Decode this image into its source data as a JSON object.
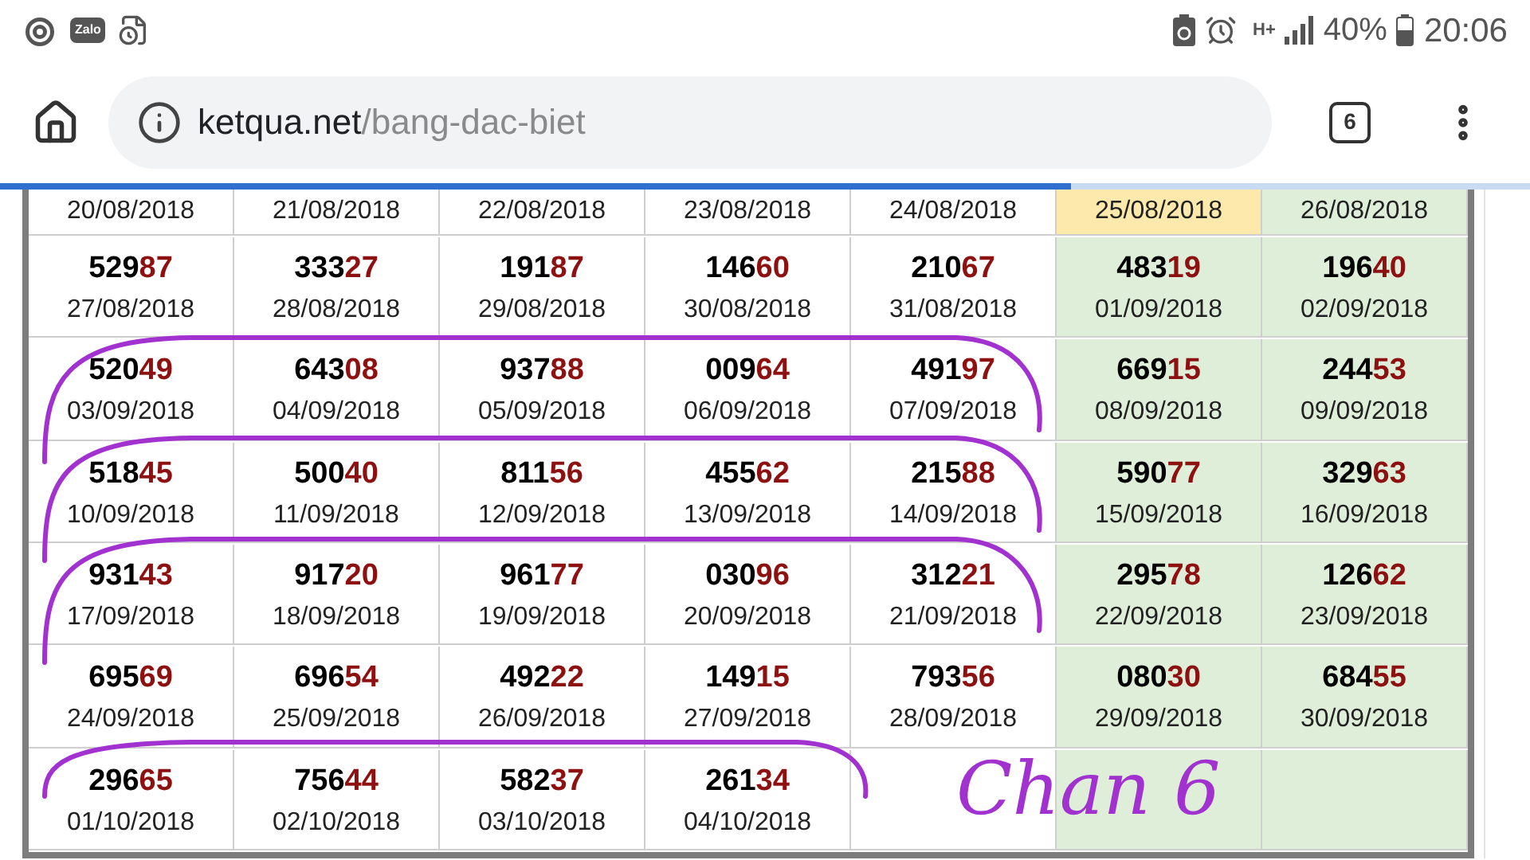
{
  "status_bar": {
    "zalo_label": "Zalo",
    "network": "H+",
    "battery": "40%",
    "time": "20:06"
  },
  "address_bar": {
    "domain": "ketqua.net",
    "path": "/bang-dac-biet",
    "tab_count": "6"
  },
  "progress": {
    "level": 0.7
  },
  "table": {
    "rows": [
      {
        "cells": [
          {
            "date": "20/08/2018",
            "kind": "plain"
          },
          {
            "date": "21/08/2018",
            "kind": "plain"
          },
          {
            "date": "22/08/2018",
            "kind": "plain"
          },
          {
            "date": "23/08/2018",
            "kind": "plain"
          },
          {
            "date": "24/08/2018",
            "kind": "plain"
          },
          {
            "date": "25/08/2018",
            "kind": "today"
          },
          {
            "date": "26/08/2018",
            "kind": "weekend"
          }
        ]
      },
      {
        "cells": [
          {
            "number_head": "529",
            "number_tail": "87",
            "date": "27/08/2018",
            "kind": "plain"
          },
          {
            "number_head": "333",
            "number_tail": "27",
            "date": "28/08/2018",
            "kind": "plain"
          },
          {
            "number_head": "191",
            "number_tail": "87",
            "date": "29/08/2018",
            "kind": "plain"
          },
          {
            "number_head": "146",
            "number_tail": "60",
            "date": "30/08/2018",
            "kind": "plain"
          },
          {
            "number_head": "210",
            "number_tail": "67",
            "date": "31/08/2018",
            "kind": "plain"
          },
          {
            "number_head": "483",
            "number_tail": "19",
            "date": "01/09/2018",
            "kind": "weekend"
          },
          {
            "number_head": "196",
            "number_tail": "40",
            "date": "02/09/2018",
            "kind": "weekend"
          }
        ]
      },
      {
        "cells": [
          {
            "number_head": "520",
            "number_tail": "49",
            "date": "03/09/2018",
            "kind": "plain"
          },
          {
            "number_head": "643",
            "number_tail": "08",
            "date": "04/09/2018",
            "kind": "plain"
          },
          {
            "number_head": "937",
            "number_tail": "88",
            "date": "05/09/2018",
            "kind": "plain"
          },
          {
            "number_head": "009",
            "number_tail": "64",
            "date": "06/09/2018",
            "kind": "plain"
          },
          {
            "number_head": "491",
            "number_tail": "97",
            "date": "07/09/2018",
            "kind": "plain"
          },
          {
            "number_head": "669",
            "number_tail": "15",
            "date": "08/09/2018",
            "kind": "weekend"
          },
          {
            "number_head": "244",
            "number_tail": "53",
            "date": "09/09/2018",
            "kind": "weekend"
          }
        ]
      },
      {
        "cells": [
          {
            "number_head": "518",
            "number_tail": "45",
            "date": "10/09/2018",
            "kind": "plain"
          },
          {
            "number_head": "500",
            "number_tail": "40",
            "date": "11/09/2018",
            "kind": "plain"
          },
          {
            "number_head": "811",
            "number_tail": "56",
            "date": "12/09/2018",
            "kind": "plain"
          },
          {
            "number_head": "455",
            "number_tail": "62",
            "date": "13/09/2018",
            "kind": "plain"
          },
          {
            "number_head": "215",
            "number_tail": "88",
            "date": "14/09/2018",
            "kind": "plain"
          },
          {
            "number_head": "590",
            "number_tail": "77",
            "date": "15/09/2018",
            "kind": "weekend"
          },
          {
            "number_head": "329",
            "number_tail": "63",
            "date": "16/09/2018",
            "kind": "weekend"
          }
        ]
      },
      {
        "cells": [
          {
            "number_head": "931",
            "number_tail": "43",
            "date": "17/09/2018",
            "kind": "plain"
          },
          {
            "number_head": "917",
            "number_tail": "20",
            "date": "18/09/2018",
            "kind": "plain"
          },
          {
            "number_head": "961",
            "number_tail": "77",
            "date": "19/09/2018",
            "kind": "plain"
          },
          {
            "number_head": "030",
            "number_tail": "96",
            "date": "20/09/2018",
            "kind": "plain"
          },
          {
            "number_head": "312",
            "number_tail": "21",
            "date": "21/09/2018",
            "kind": "plain"
          },
          {
            "number_head": "295",
            "number_tail": "78",
            "date": "22/09/2018",
            "kind": "weekend"
          },
          {
            "number_head": "126",
            "number_tail": "62",
            "date": "23/09/2018",
            "kind": "weekend"
          }
        ]
      },
      {
        "cells": [
          {
            "number_head": "695",
            "number_tail": "69",
            "date": "24/09/2018",
            "kind": "plain"
          },
          {
            "number_head": "696",
            "number_tail": "54",
            "date": "25/09/2018",
            "kind": "plain"
          },
          {
            "number_head": "492",
            "number_tail": "22",
            "date": "26/09/2018",
            "kind": "plain"
          },
          {
            "number_head": "149",
            "number_tail": "15",
            "date": "27/09/2018",
            "kind": "plain"
          },
          {
            "number_head": "793",
            "number_tail": "56",
            "date": "28/09/2018",
            "kind": "plain"
          },
          {
            "number_head": "080",
            "number_tail": "30",
            "date": "29/09/2018",
            "kind": "weekend"
          },
          {
            "number_head": "684",
            "number_tail": "55",
            "date": "30/09/2018",
            "kind": "weekend"
          }
        ]
      },
      {
        "cells": [
          {
            "number_head": "296",
            "number_tail": "65",
            "date": "01/10/2018",
            "kind": "plain"
          },
          {
            "number_head": "756",
            "number_tail": "44",
            "date": "02/10/2018",
            "kind": "plain"
          },
          {
            "number_head": "582",
            "number_tail": "37",
            "date": "03/10/2018",
            "kind": "plain"
          },
          {
            "number_head": "261",
            "number_tail": "34",
            "date": "04/10/2018",
            "kind": "plain"
          },
          {
            "kind": "plain"
          },
          {
            "kind": "weekend"
          },
          {
            "kind": "weekend"
          }
        ]
      }
    ]
  },
  "annotation": {
    "text": "Chan 6"
  }
}
